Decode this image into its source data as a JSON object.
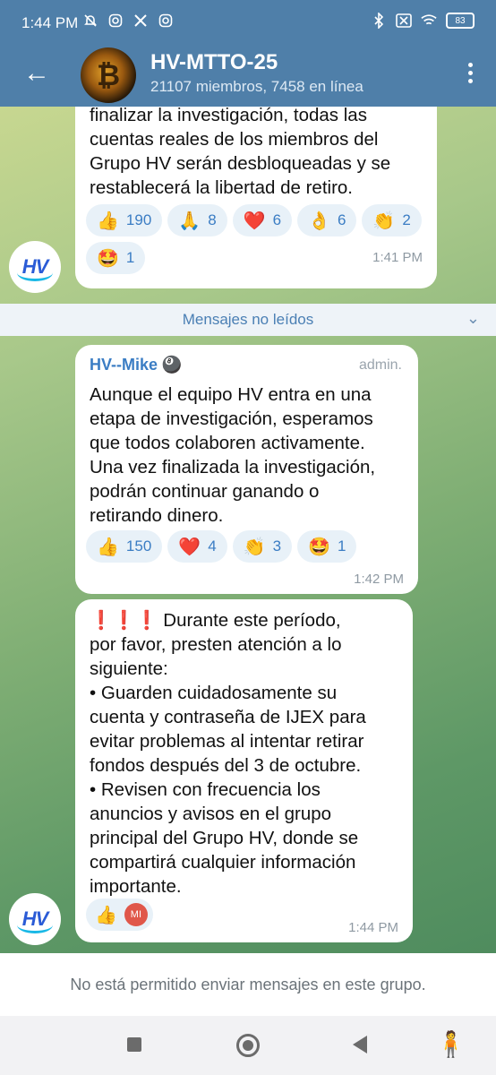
{
  "status_bar": {
    "time": "1:44 PM",
    "left_icons": [
      "mute-bell-icon",
      "instagram-icon",
      "x-icon",
      "instagram-icon"
    ],
    "right_icons": [
      "bluetooth-icon",
      "no-sim-icon",
      "wifi-icon"
    ],
    "battery": "83"
  },
  "header": {
    "back_icon": "←",
    "title": "HV-MTTO-25",
    "subtitle": "21107 miembros, 7458 en línea",
    "avatar_symbol": "₿"
  },
  "messages": [
    {
      "text": "finalizar la investigación, todas las\ncuentas reales de los miembros del\nGrupo HV serán desbloqueadas y se\nrestablecerá la libertad de retiro.",
      "reactions": [
        {
          "emoji": "👍",
          "count": "190"
        },
        {
          "emoji": "🙏",
          "count": "8"
        },
        {
          "emoji": "❤️",
          "count": "6"
        },
        {
          "emoji": "👌",
          "count": "6"
        },
        {
          "emoji": "👏",
          "count": "2"
        },
        {
          "emoji": "🤩",
          "count": "1"
        }
      ],
      "time": "1:41 PM"
    },
    {
      "sender": "HV--Mike",
      "sender_badge": "🎱",
      "role": "admin.",
      "text": "Aunque el equipo HV entra en una\netapa de investigación, esperamos\nque todos colaboren activamente.\nUna vez finalizada la investigación,\npodrán continuar ganando o\nretirando dinero.",
      "reactions": [
        {
          "emoji": "👍",
          "count": "150"
        },
        {
          "emoji": "❤️",
          "count": "4"
        },
        {
          "emoji": "👏",
          "count": "3"
        },
        {
          "emoji": "🤩",
          "count": "1"
        }
      ],
      "time": "1:42 PM"
    },
    {
      "text": "❗❗❗ Durante este período,\npor favor, presten atención a lo\nsiguiente:\n• Guarden cuidadosamente su\ncuenta y contraseña de IJEX para\nevitar problemas al intentar retirar\nfondos después del 3 de octubre.\n• Revisen con frecuencia los\nanuncios y avisos en el grupo\nprincipal del Grupo HV, donde se\ncompartirá cualquier información\nimportante.",
      "reactions": [
        {
          "emoji": "👍",
          "reactor_initials": "MI"
        }
      ],
      "time": "1:44 PM"
    }
  ],
  "unread_label": "Mensajes no leídos",
  "hv_avatar_label": "HV",
  "footer": {
    "notice": "No está permitido enviar mensajes en este grupo."
  },
  "colors": {
    "header": "#4f7fa9",
    "link": "#3b7dc4",
    "reaction_bg": "#e8f1f8"
  }
}
